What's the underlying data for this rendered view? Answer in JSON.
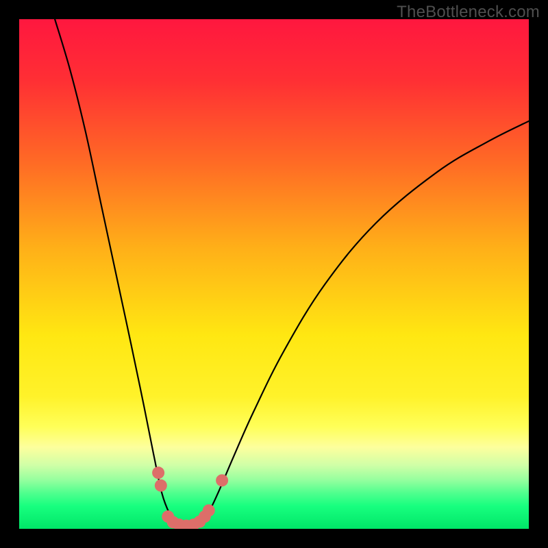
{
  "watermark": "TheBottleneck.com",
  "chart_data": {
    "type": "line",
    "title": "",
    "xlabel": "",
    "ylabel": "",
    "xlim": [
      0,
      100
    ],
    "ylim": [
      0,
      100
    ],
    "grid": false,
    "legend": false,
    "background": {
      "type": "vertical-gradient",
      "stops": [
        {
          "offset": 0.0,
          "color": "#ff173f"
        },
        {
          "offset": 0.12,
          "color": "#ff2f34"
        },
        {
          "offset": 0.28,
          "color": "#ff6a25"
        },
        {
          "offset": 0.45,
          "color": "#ffb018"
        },
        {
          "offset": 0.62,
          "color": "#ffe712"
        },
        {
          "offset": 0.74,
          "color": "#fff22a"
        },
        {
          "offset": 0.8,
          "color": "#ffff59"
        },
        {
          "offset": 0.84,
          "color": "#fdff9d"
        },
        {
          "offset": 0.875,
          "color": "#d0ffa7"
        },
        {
          "offset": 0.905,
          "color": "#93ff9e"
        },
        {
          "offset": 0.93,
          "color": "#4fff8e"
        },
        {
          "offset": 0.955,
          "color": "#18ff7f"
        },
        {
          "offset": 1.0,
          "color": "#00e668"
        }
      ]
    },
    "series": [
      {
        "name": "left-arm",
        "stroke": "#000000",
        "stroke_width": 2.2,
        "type": "bezier",
        "points": [
          {
            "x": 7.0,
            "y": 100.0
          },
          {
            "x": 10.0,
            "y": 90.0
          },
          {
            "x": 13.0,
            "y": 78.0
          },
          {
            "x": 16.0,
            "y": 64.0
          },
          {
            "x": 19.0,
            "y": 50.0
          },
          {
            "x": 22.0,
            "y": 36.0
          },
          {
            "x": 24.5,
            "y": 24.0
          },
          {
            "x": 26.5,
            "y": 14.0
          },
          {
            "x": 28.0,
            "y": 7.0
          },
          {
            "x": 29.5,
            "y": 3.0
          },
          {
            "x": 31.0,
            "y": 1.0
          },
          {
            "x": 33.0,
            "y": 0.3
          }
        ]
      },
      {
        "name": "right-arm",
        "stroke": "#000000",
        "stroke_width": 2.2,
        "type": "bezier",
        "points": [
          {
            "x": 33.0,
            "y": 0.3
          },
          {
            "x": 35.0,
            "y": 1.0
          },
          {
            "x": 37.0,
            "y": 3.0
          },
          {
            "x": 39.0,
            "y": 7.0
          },
          {
            "x": 42.0,
            "y": 14.0
          },
          {
            "x": 46.0,
            "y": 23.0
          },
          {
            "x": 52.0,
            "y": 35.0
          },
          {
            "x": 60.0,
            "y": 48.0
          },
          {
            "x": 70.0,
            "y": 60.0
          },
          {
            "x": 82.0,
            "y": 70.0
          },
          {
            "x": 92.0,
            "y": 76.0
          },
          {
            "x": 100.0,
            "y": 80.0
          }
        ]
      }
    ],
    "markers": {
      "color": "#dd6e69",
      "radius": 9,
      "points": [
        {
          "x": 27.3,
          "y": 11.0
        },
        {
          "x": 27.8,
          "y": 8.5
        },
        {
          "x": 29.2,
          "y": 2.4
        },
        {
          "x": 30.2,
          "y": 1.3
        },
        {
          "x": 31.4,
          "y": 0.8
        },
        {
          "x": 32.8,
          "y": 0.6
        },
        {
          "x": 34.2,
          "y": 0.8
        },
        {
          "x": 35.4,
          "y": 1.4
        },
        {
          "x": 36.4,
          "y": 2.4
        },
        {
          "x": 37.2,
          "y": 3.6
        },
        {
          "x": 39.8,
          "y": 9.5
        }
      ]
    }
  }
}
